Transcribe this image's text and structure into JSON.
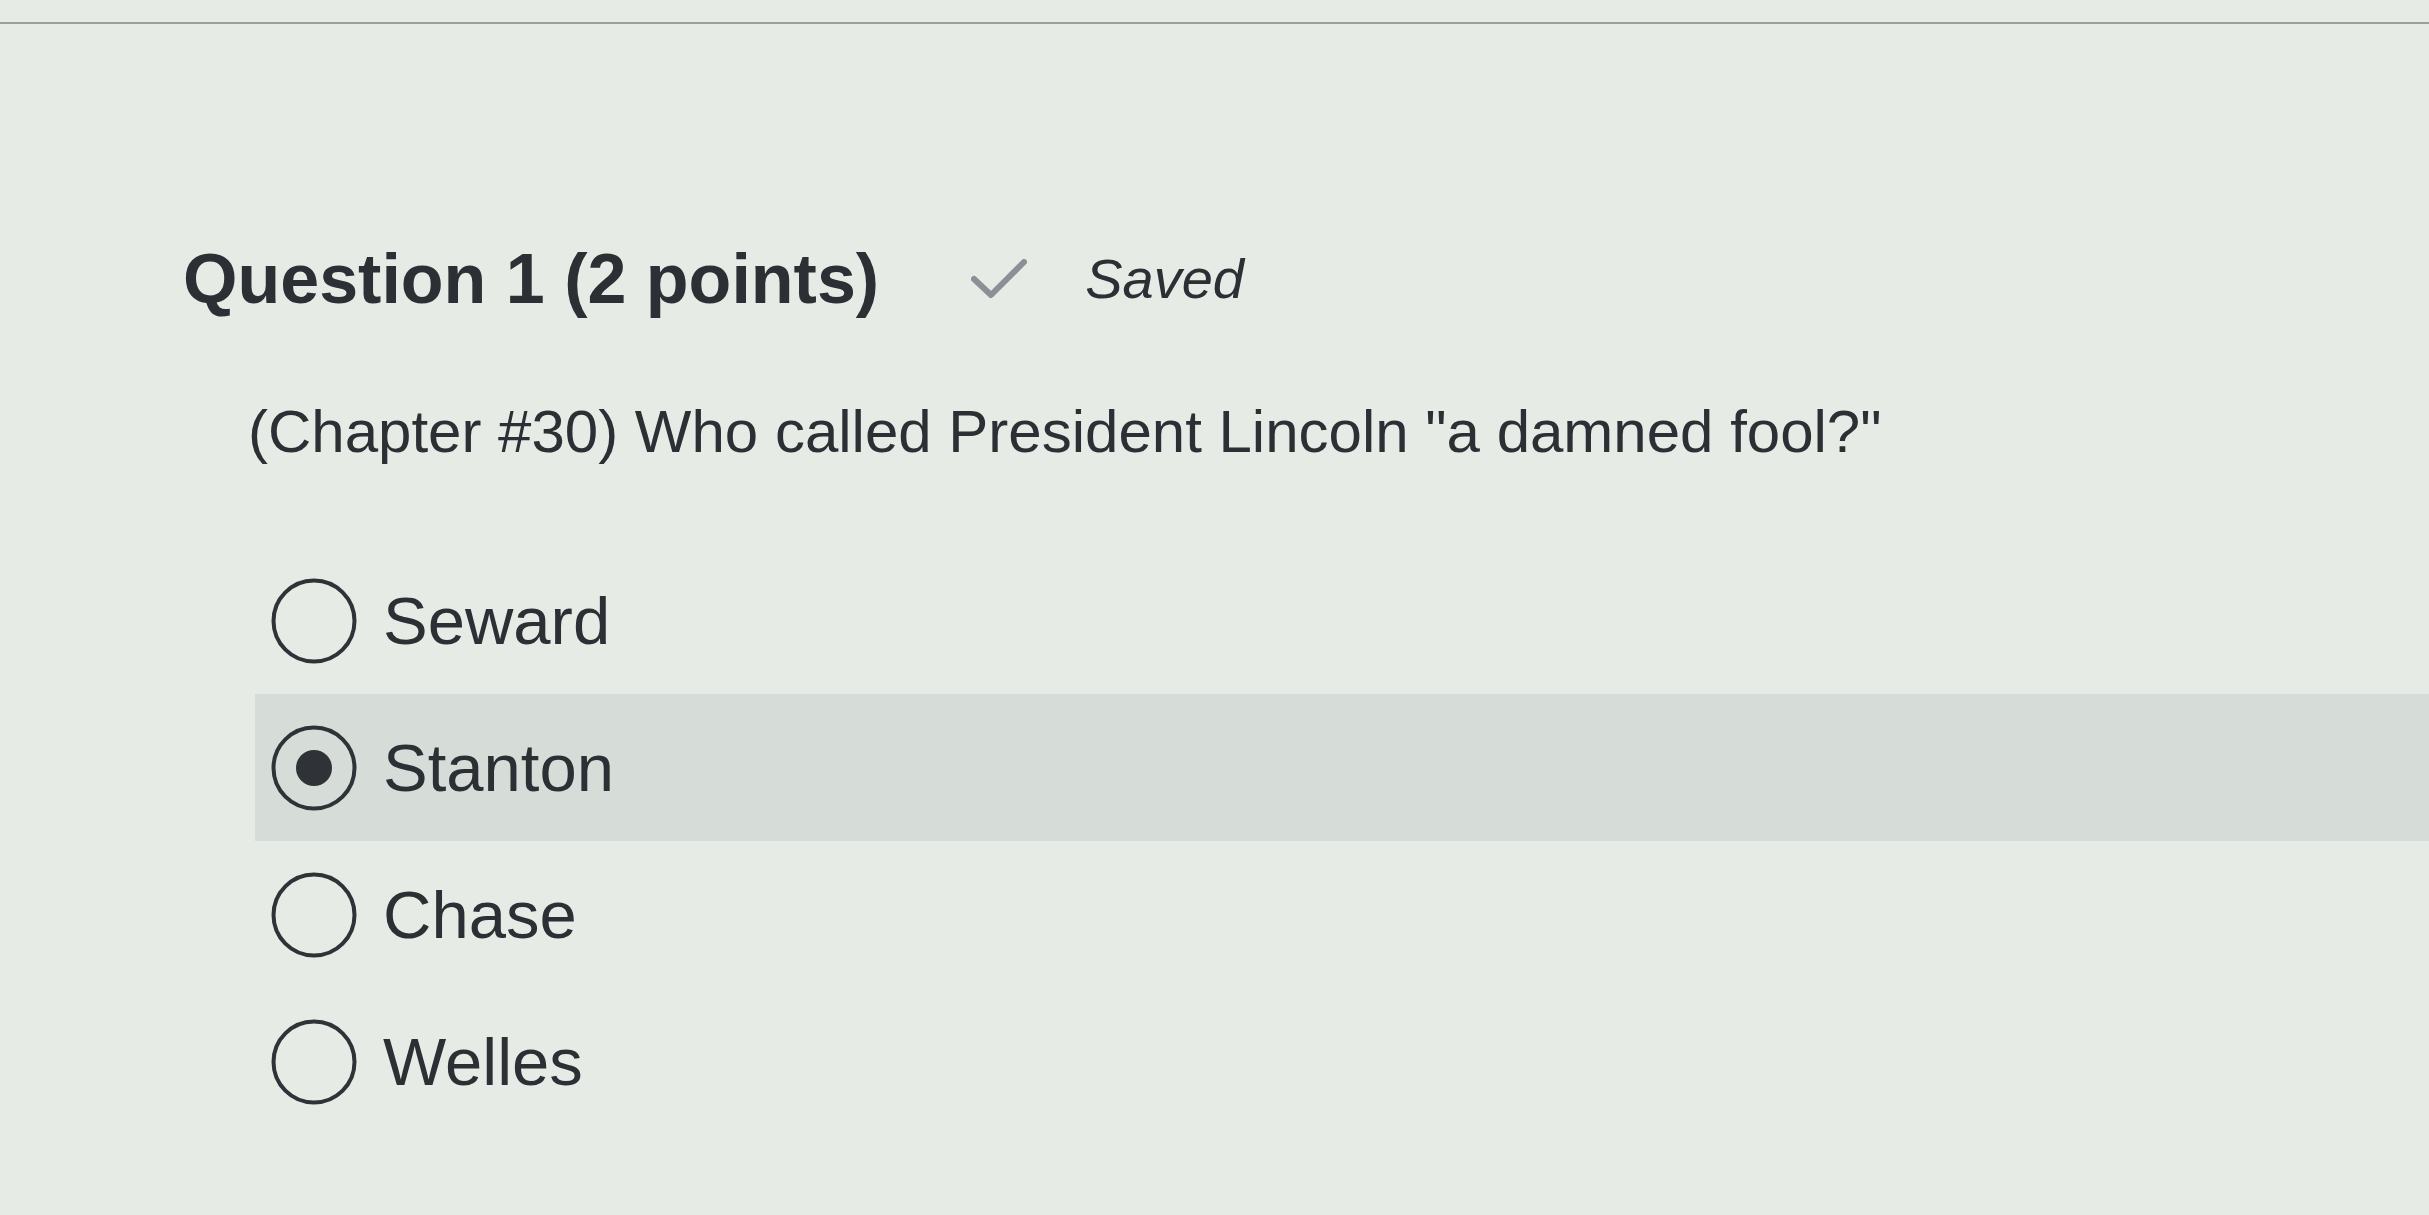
{
  "question": {
    "title": "Question 1 (2 points)",
    "status": {
      "kind": "saved",
      "label": "Saved"
    },
    "text": "(Chapter #30) Who called President Lincoln \"a damned fool?\""
  },
  "options": [
    {
      "label": "Seward",
      "selected": false
    },
    {
      "label": "Stanton",
      "selected": true
    },
    {
      "label": "Chase",
      "selected": false
    },
    {
      "label": "Welles",
      "selected": false
    }
  ]
}
